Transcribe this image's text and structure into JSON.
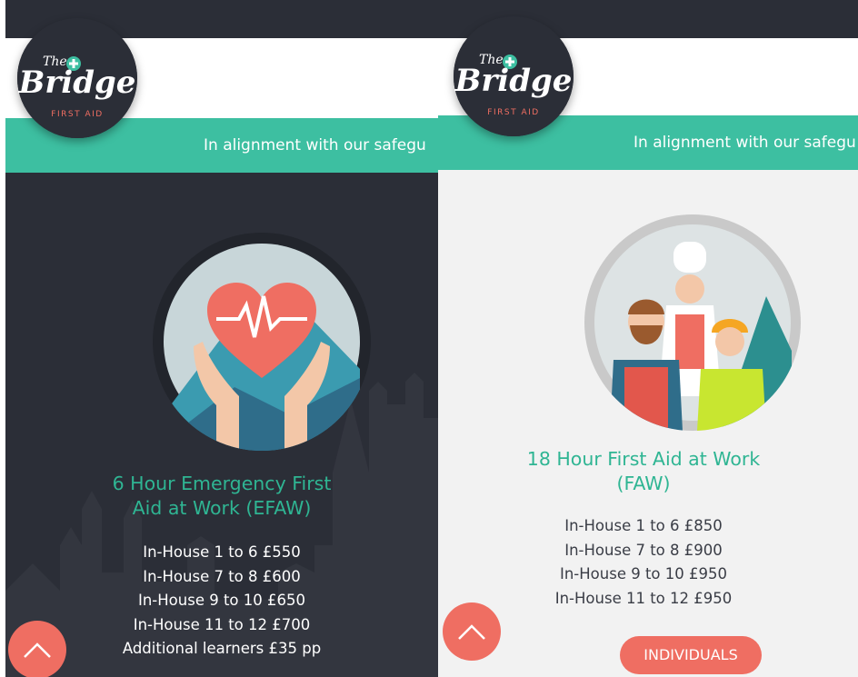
{
  "brand": {
    "logo_script_top": "The",
    "logo_script_main": "Bridge",
    "logo_subtitle": "FIRST AID"
  },
  "colors": {
    "dark": "#2b2e37",
    "teal": "#3dbfa1",
    "title_teal": "#2fb593",
    "coral": "#ef6e62",
    "light_bg": "#f2f2f2"
  },
  "left": {
    "banner_text": "In alignment with our safegu",
    "course": {
      "title_line1": "6 Hour Emergency First",
      "title_line2": "Aid at Work (EFAW)",
      "prices": [
        "In-House 1 to 6 £550",
        "In-House 7 to 8 £600",
        "In-House 9 to 10 £650",
        "In-House 11 to 12 £700",
        "Additional learners £35 pp"
      ],
      "icon": "heart-in-hands-icon"
    },
    "scroll_icon": "chevron-up-icon"
  },
  "right": {
    "banner_text": "In alignment with our safegu",
    "course": {
      "title_line1": "18 Hour First Aid at Work",
      "title_line2": "(FAW)",
      "prices": [
        "In-House 1 to 6 £850",
        "In-House 7 to 8 £900",
        "In-House 9 to 10 £950",
        "In-House 11 to 12 £950"
      ],
      "icon": "workers-icon"
    },
    "button_label": "INDIVIDUALS",
    "scroll_icon": "chevron-up-icon"
  }
}
